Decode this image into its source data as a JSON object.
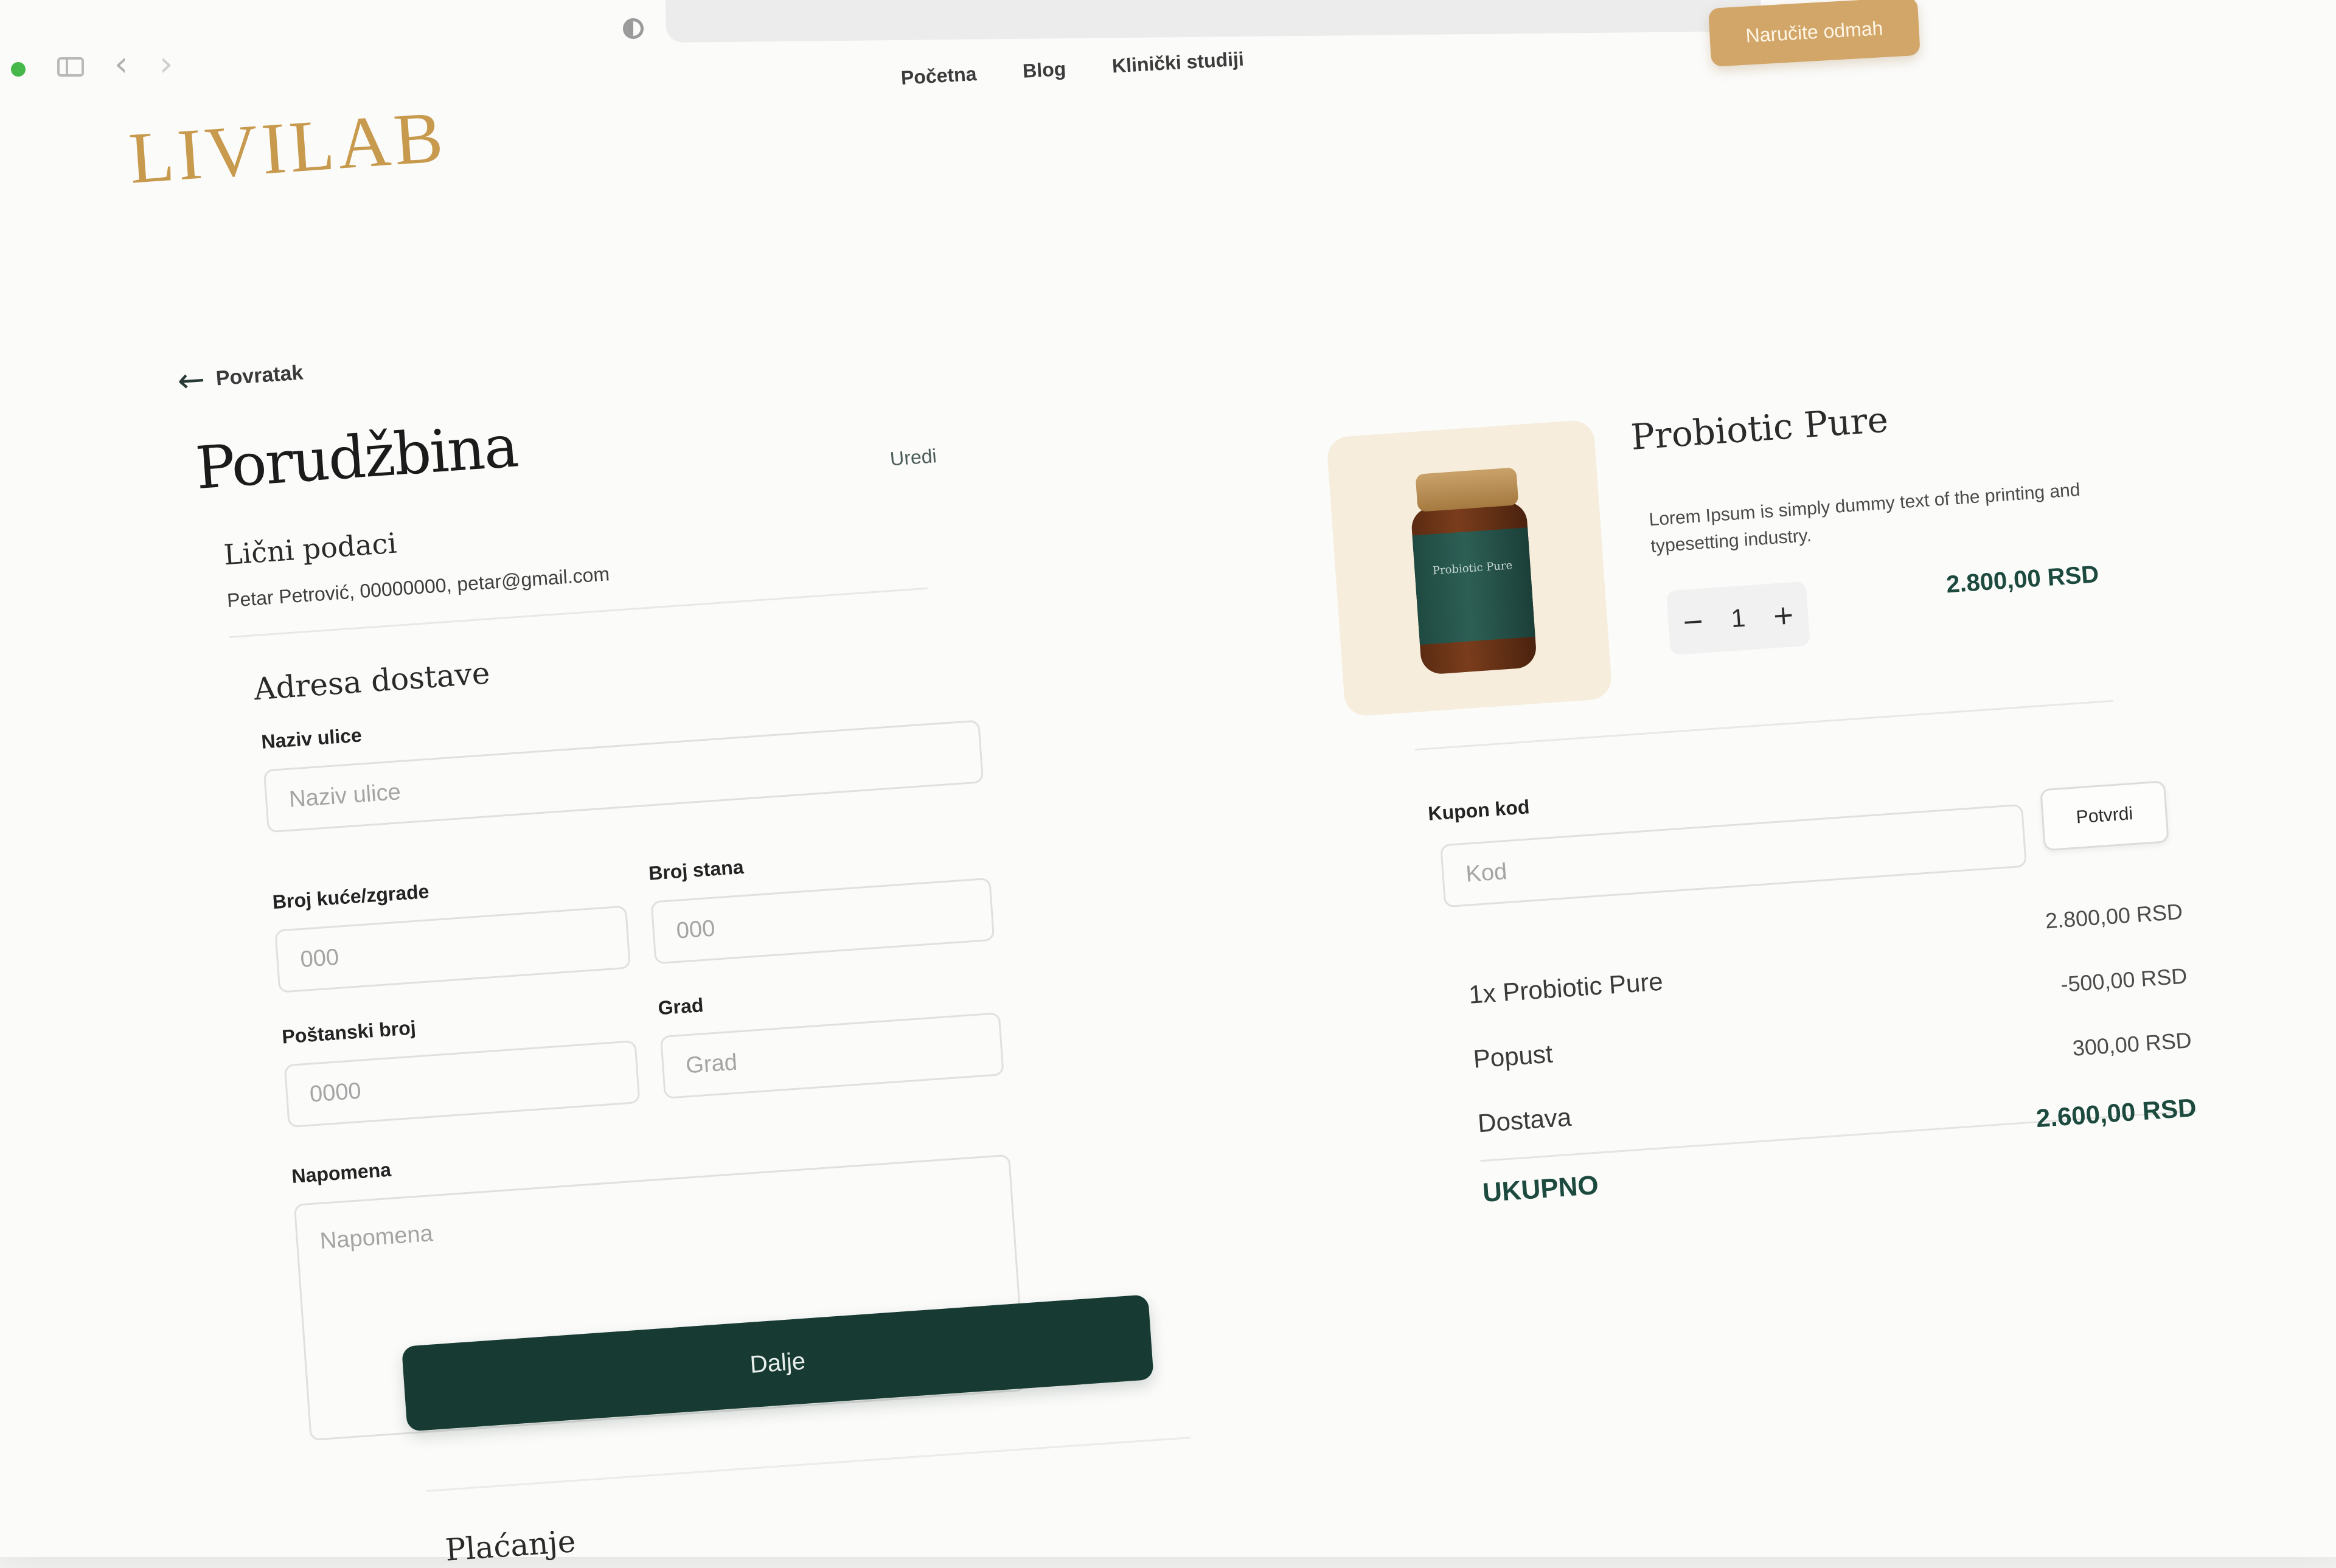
{
  "header": {
    "logo": "LIVILAB",
    "nav": [
      "Početna",
      "Blog",
      "Klinički studiji"
    ],
    "cta_label": "Naručite odmah"
  },
  "checkout": {
    "back_label": "Povratak",
    "title": "Porudžbina",
    "personal": {
      "title": "Lični podaci",
      "edit_label": "Uredi",
      "info": "Petar Petrović, 00000000, petar@gmail.com"
    },
    "address": {
      "title": "Adresa dostave",
      "street_label": "Naziv ulice",
      "street_placeholder": "Naziv ulice",
      "house_label": "Broj kuće/zgrade",
      "house_placeholder": "000",
      "apt_label": "Broj stana",
      "apt_placeholder": "000",
      "postal_label": "Poštanski broj",
      "postal_placeholder": "0000",
      "city_label": "Grad",
      "city_placeholder": "Grad",
      "note_label": "Napomena",
      "note_placeholder": "Napomena"
    },
    "next_label": "Dalje",
    "payment_title": "Plaćanje"
  },
  "cart": {
    "product_name": "Probiotic Pure",
    "product_description": "Lorem Ipsum is simply dummy text of the printing and typesetting industry.",
    "product_price": "2.800,00 RSD",
    "quantity": "1",
    "bottle_text": "Probiotic Pure",
    "coupon_label": "Kupon kod",
    "coupon_placeholder": "Kod",
    "confirm_label": "Potvrdi",
    "summary": [
      {
        "label": "1x Probiotic Pure",
        "amount": "2.800,00 RSD"
      },
      {
        "label": "Popust",
        "amount": "-500,00 RSD"
      },
      {
        "label": "Dostava",
        "amount": "300,00 RSD"
      }
    ],
    "total_label": "UKUPNO",
    "total_amount": "2.600,00 RSD"
  },
  "colors": {
    "accent_gold": "#c79a4e",
    "primary_green": "#173b32",
    "price_green": "#1d4a3e"
  }
}
